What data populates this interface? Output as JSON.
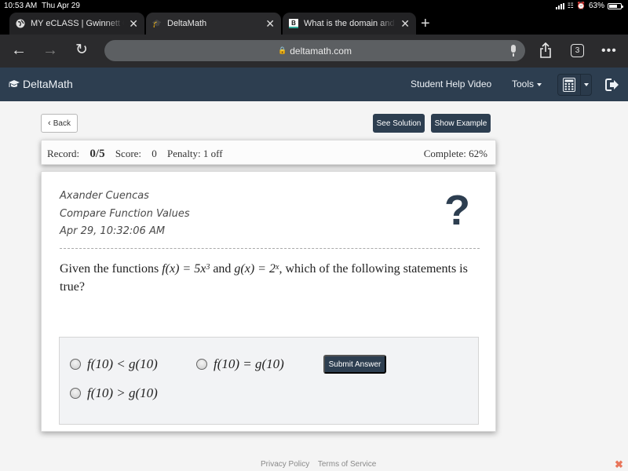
{
  "status_bar": {
    "time": "10:53 AM",
    "date": "Thu Apr 29",
    "battery": "63%"
  },
  "browser": {
    "tabs": [
      {
        "label": "MY eCLASS | Gwinnett County",
        "icon": "globe-icon",
        "active": false
      },
      {
        "label": "DeltaMath",
        "icon": "graduation-cap-icon",
        "active": true
      },
      {
        "label": "What is the domain and range",
        "icon": "brainly-icon",
        "active": false
      }
    ],
    "url": "deltamath.com",
    "tab_count": "3"
  },
  "header": {
    "brand": "DeltaMath",
    "help_video": "Student Help Video",
    "tools": "Tools"
  },
  "toolbar": {
    "back_label": "Back",
    "see_solution_label": "See Solution",
    "show_example_label": "Show Example"
  },
  "record": {
    "record_label": "Record:",
    "record_value": "0/5",
    "score_label": "Score:",
    "score_value": "0",
    "penalty": "Penalty: 1 off",
    "complete": "Complete: 62%"
  },
  "problem": {
    "student_name": "Axander Cuencas",
    "topic": "Compare Function Values",
    "timestamp": "Apr 29, 10:32:06 AM",
    "question_prefix": "Given the functions ",
    "f_def": "f(x) = 5x",
    "f_exp": "3",
    "and": " and ",
    "g_def": "g(x) = 2",
    "g_exp": "x",
    "question_suffix": ", which of the following statements is true?",
    "options": [
      "f(10) < g(10)",
      "f(10) = g(10)",
      "f(10) > g(10)"
    ],
    "submit_label": "Submit Answer"
  },
  "footer": {
    "privacy": "Privacy Policy",
    "terms": "Terms of Service"
  },
  "colors": {
    "brand_navy": "#2d3e50",
    "close_accent": "#e8765b"
  }
}
